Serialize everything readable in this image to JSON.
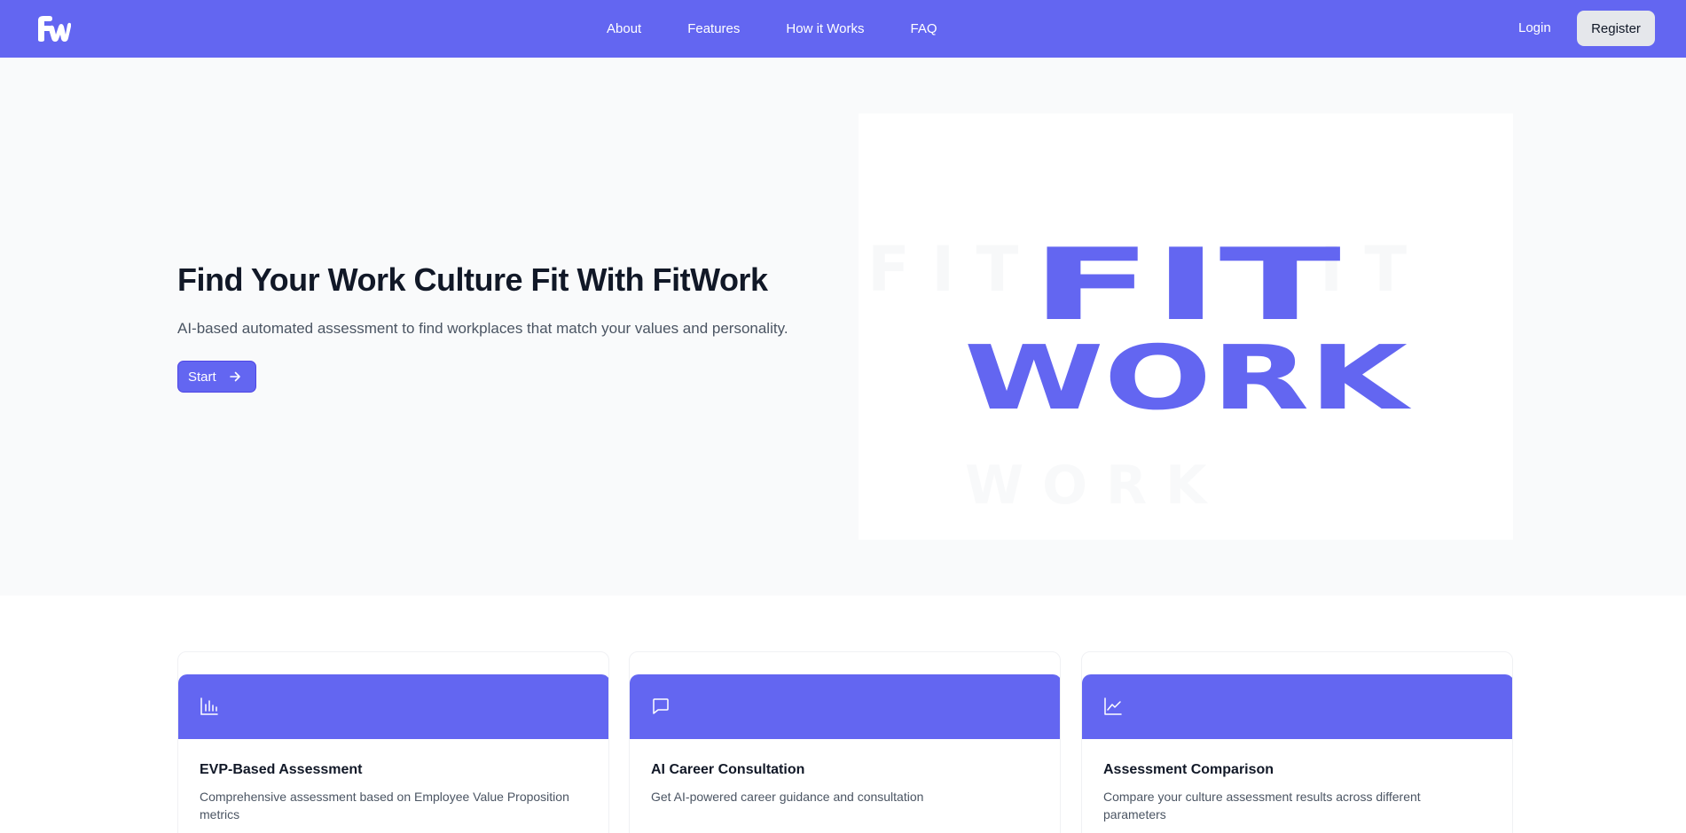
{
  "brand": {
    "logo_text": "FW",
    "color": "#6366f1"
  },
  "nav": {
    "links": [
      "About",
      "Features",
      "How it Works",
      "FAQ"
    ],
    "login_label": "Login",
    "register_label": "Register"
  },
  "hero": {
    "title": "Find Your Work Culture Fit With FitWork",
    "subtitle": "AI-based automated assessment to find workplaces that match your values and personality.",
    "start_label": "Start",
    "start_icon": "arrow-right-icon",
    "image": {
      "line1": "FIT",
      "line2": "WORK"
    }
  },
  "features": [
    {
      "icon": "bar-chart-icon",
      "title": "EVP-Based Assessment",
      "description": "Comprehensive assessment based on Employee Value Proposition metrics"
    },
    {
      "icon": "message-square-icon",
      "title": "AI Career Consultation",
      "description": "Get AI-powered career guidance and consultation"
    },
    {
      "icon": "line-chart-icon",
      "title": "Assessment Comparison",
      "description": "Compare your culture assessment results across different parameters"
    }
  ]
}
